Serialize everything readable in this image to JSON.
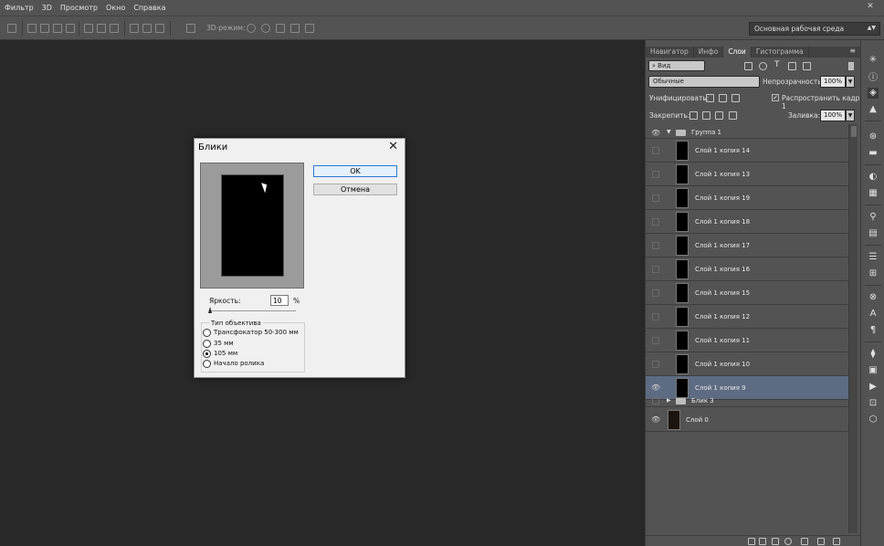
{
  "menu": [
    "Фильтр",
    "3D",
    "Просмотр",
    "Окно",
    "Справка"
  ],
  "options_bar": {
    "mode_3d_label": "3D-режим:",
    "workspace": "Основная рабочая среда"
  },
  "panel": {
    "tabs": [
      "Навигатор",
      "Инфо",
      "Слои",
      "Гистограмма"
    ],
    "active_tab": "Слои",
    "kind_filter": "Вид",
    "blend_mode": "Обычные",
    "opacity_label": "Непрозрачность:",
    "opacity_value": "100%",
    "unify_label": "Унифицировать:",
    "propagate_label": "Распространить кадр 1",
    "lock_label": "Закрепить:",
    "fill_label": "Заливка:",
    "fill_value": "100%",
    "group_name": "Группа 1",
    "layers": [
      {
        "name": "Слой 1 копия 14",
        "visible": false,
        "selected": false
      },
      {
        "name": "Слой 1 копия 13",
        "visible": false,
        "selected": false
      },
      {
        "name": "Слой 1 копия 19",
        "visible": false,
        "selected": false
      },
      {
        "name": "Слой 1 копия 18",
        "visible": false,
        "selected": false
      },
      {
        "name": "Слой 1 копия 17",
        "visible": false,
        "selected": false
      },
      {
        "name": "Слой 1 копия 16",
        "visible": false,
        "selected": false
      },
      {
        "name": "Слой 1 копия 15",
        "visible": false,
        "selected": false
      },
      {
        "name": "Слой 1 копия 12",
        "visible": false,
        "selected": false
      },
      {
        "name": "Слой 1 копия 11",
        "visible": false,
        "selected": false
      },
      {
        "name": "Слой 1 копия 10",
        "visible": false,
        "selected": false
      },
      {
        "name": "Слой 1 копия 9",
        "visible": true,
        "selected": true
      }
    ],
    "collapsed_group": "Блик 3",
    "base_layer": "Слой 0"
  },
  "dialog": {
    "title": "Блики",
    "ok_label": "OK",
    "cancel_label": "Отмена",
    "brightness_label": "Яркость:",
    "brightness_value": "10",
    "brightness_unit": "%",
    "lens_legend": "Тип объектива",
    "lens_options": [
      {
        "label": "Трансфокатор 50-300 мм",
        "selected": false
      },
      {
        "label": "35 мм",
        "selected": false
      },
      {
        "label": "105 мм",
        "selected": true
      },
      {
        "label": "Начало ролика",
        "selected": false
      }
    ]
  },
  "icons": {
    "close": "close-icon",
    "eye": "eye-icon",
    "folder": "folder-icon"
  }
}
